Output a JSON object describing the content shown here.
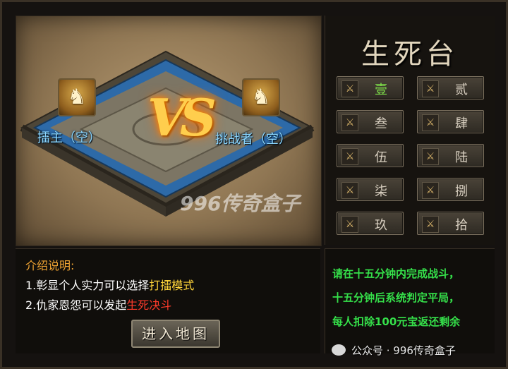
{
  "title": "生死台",
  "arena": {
    "vs_text": "VS",
    "left_seat": {
      "icon": "warrior-icon",
      "label": "擂主（空）"
    },
    "right_seat": {
      "icon": "warrior-icon",
      "label": "挑战者（空）"
    },
    "watermark": "996传奇盒子"
  },
  "stages": [
    {
      "label": "壹",
      "active": true
    },
    {
      "label": "贰",
      "active": false
    },
    {
      "label": "叁",
      "active": false
    },
    {
      "label": "肆",
      "active": false
    },
    {
      "label": "伍",
      "active": false
    },
    {
      "label": "陆",
      "active": false
    },
    {
      "label": "柒",
      "active": false
    },
    {
      "label": "捌",
      "active": false
    },
    {
      "label": "玖",
      "active": false
    },
    {
      "label": "拾",
      "active": false
    }
  ],
  "intro": {
    "title": "介绍说明:",
    "line1_prefix": "1.彰显个人实力可以选择",
    "line1_highlight": "打擂模式",
    "line2_prefix": "2.仇家恩怨可以发起",
    "line2_highlight": "生死决斗",
    "enter_button": "进入地图"
  },
  "rules": [
    "请在十五分钟内完成战斗，",
    "十五分钟后系统判定平局，",
    "每人扣除100元宝返还剩余"
  ],
  "footer": {
    "wechat_text": "公众号 · 996传奇盒子"
  },
  "colors": {
    "active_stage": "#7fe04a",
    "rules_text": "#35e04a",
    "seat_label": "#8ad6ff",
    "highlight_yellow": "#ffd53a",
    "highlight_red": "#ff3b2b"
  }
}
